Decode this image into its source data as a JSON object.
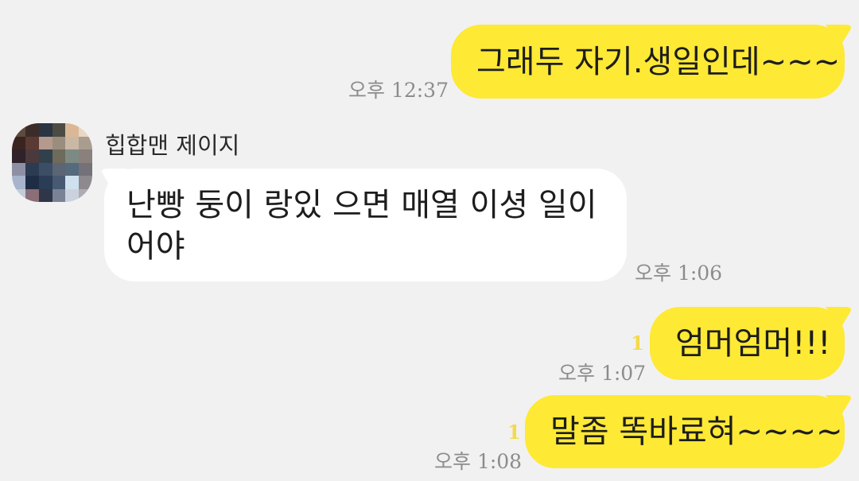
{
  "chat": {
    "messages": [
      {
        "id": "m1",
        "from": "me",
        "text": "그래두 자기.생일인데~~~",
        "time": "오후 12:37"
      },
      {
        "id": "m2",
        "from": "other",
        "sender": "힙합맨 제이지",
        "text": "난빵 둥이 랑있 으면 매열 이셩 일이 어야",
        "time": "오후 1:06"
      },
      {
        "id": "m3",
        "from": "me",
        "text": "엄머엄머!!!",
        "time": "오후 1:07",
        "unread": "1"
      },
      {
        "id": "m4",
        "from": "me",
        "text": "말좀 똑바료혀~~~~",
        "time": "오후 1:08",
        "unread": "1"
      }
    ]
  },
  "colors": {
    "background": "#f1f1f2",
    "my_bubble": "#fee934",
    "other_bubble": "#ffffff",
    "timestamp": "#8c8c8c",
    "unread_count": "#f5d94a"
  },
  "icons": {
    "avatar": "pixelated-profile-avatar"
  }
}
